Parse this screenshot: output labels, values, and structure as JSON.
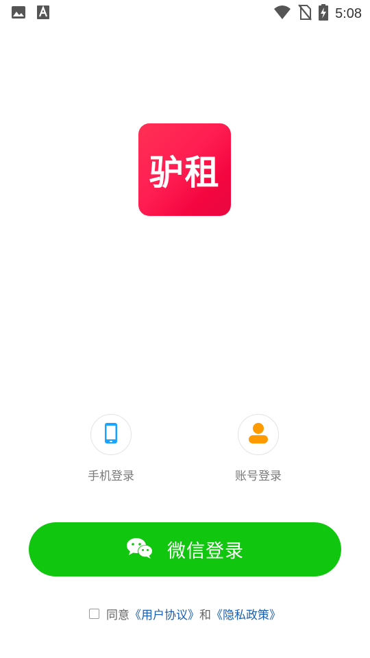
{
  "status_bar": {
    "time": "5:08",
    "icons": [
      "image-icon",
      "font-icon",
      "wifi-icon",
      "no-sim-icon",
      "battery-charging-icon"
    ]
  },
  "app": {
    "logo_text": "驴租",
    "brand_color": "#ff1e52"
  },
  "login_options": [
    {
      "label": "手机登录",
      "icon": "phone-icon",
      "color": "#1aa3ff"
    },
    {
      "label": "账号登录",
      "icon": "person-icon",
      "color": "#ff9a00"
    }
  ],
  "wechat_login": {
    "label": "微信登录",
    "color": "#10c60e"
  },
  "agreement": {
    "prefix": "同意",
    "user_agreement": "《用户协议》",
    "conjunction": "和",
    "privacy_policy": "《隐私政策》",
    "checked": false
  }
}
